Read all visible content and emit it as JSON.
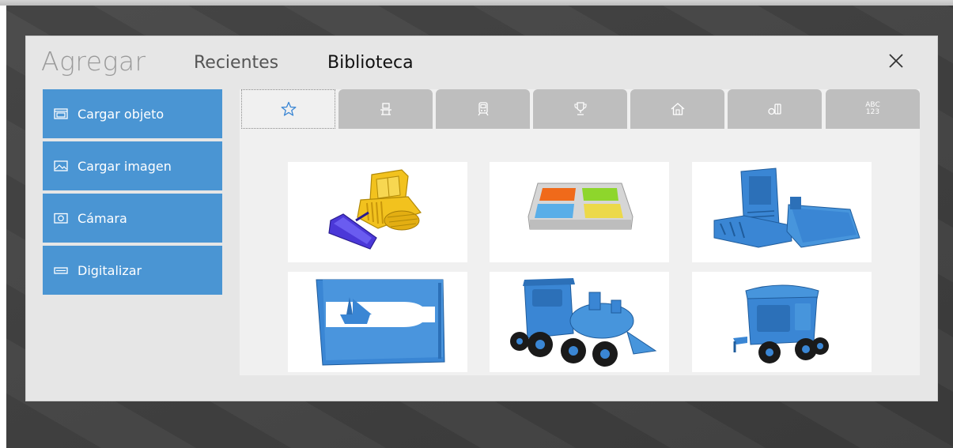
{
  "dialog": {
    "title": "Agregar",
    "tabs": {
      "recent": "Recientes",
      "library": "Biblioteca"
    }
  },
  "sidebar": {
    "items": [
      {
        "label": "Cargar objeto",
        "icon": "load-object-icon"
      },
      {
        "label": "Cargar imagen",
        "icon": "image-icon"
      },
      {
        "label": "Cámara",
        "icon": "camera-icon"
      },
      {
        "label": "Digitalizar",
        "icon": "scanner-icon"
      }
    ]
  },
  "categories": {
    "items": [
      {
        "icon": "star-icon",
        "active": true
      },
      {
        "icon": "robot-icon"
      },
      {
        "icon": "train-icon"
      },
      {
        "icon": "trophy-icon"
      },
      {
        "icon": "home-icon"
      },
      {
        "icon": "blocks-icon"
      },
      {
        "icon": "abc-icon",
        "text_top": "ABC",
        "text_bottom": "123"
      }
    ]
  },
  "library": {
    "tiles": [
      {
        "name": "bulldozer"
      },
      {
        "name": "windows-logo-tray"
      },
      {
        "name": "blue-case"
      },
      {
        "name": "bottle-boat-frame"
      },
      {
        "name": "blue-locomotive"
      },
      {
        "name": "blue-train-car"
      }
    ]
  },
  "colors": {
    "accent": "#4a95d3",
    "model_blue": "#3a86d4",
    "bulldozer_yellow": "#f2c21e",
    "blade_purple": "#4b38d8"
  }
}
